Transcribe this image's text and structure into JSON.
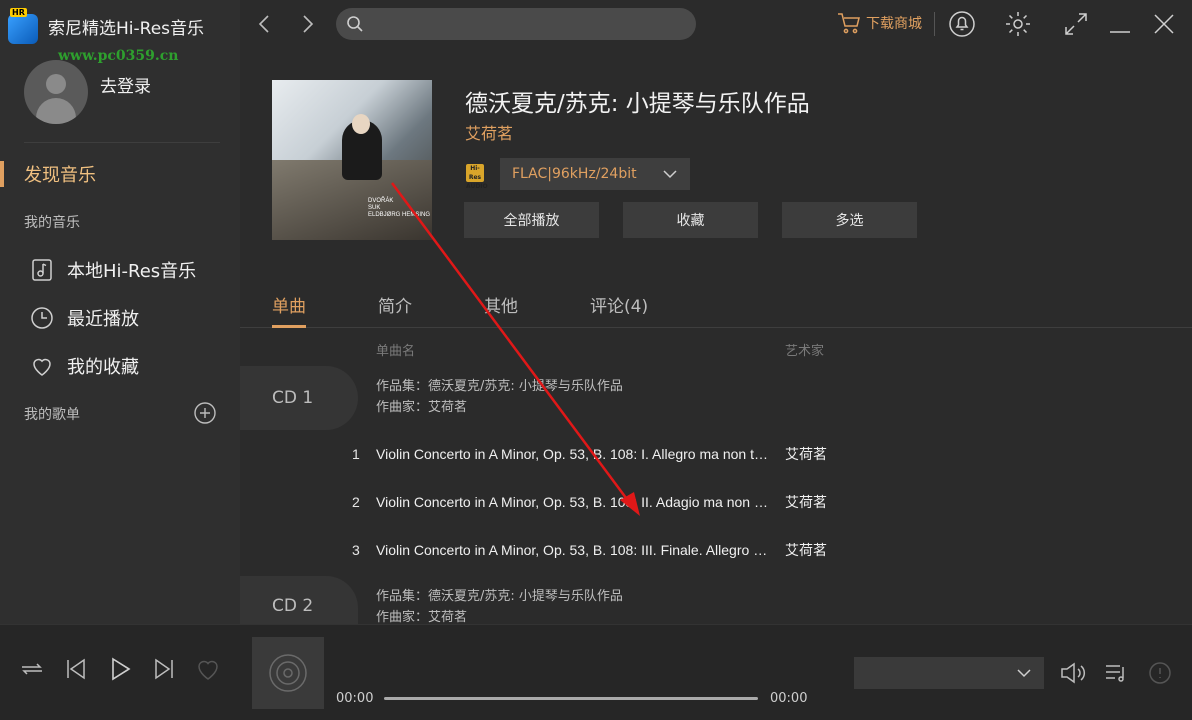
{
  "app": {
    "title": "索尼精选Hi-Res音乐",
    "logo_badge": "HR",
    "watermark": "www.pc0359.cn"
  },
  "sidebar": {
    "login": "去登录",
    "discover": "发现音乐",
    "my_music_label": "我的音乐",
    "items": [
      {
        "label": "本地Hi-Res音乐",
        "icon": "music-note-icon"
      },
      {
        "label": "最近播放",
        "icon": "clock-icon"
      },
      {
        "label": "我的收藏",
        "icon": "heart-icon"
      }
    ],
    "playlists_label": "我的歌单"
  },
  "topbar": {
    "search_placeholder": "",
    "store": "下载商城"
  },
  "album": {
    "title": "德沃夏克/苏克: 小提琴与乐队作品",
    "artist": "艾荷茗",
    "hires_badge": "Hi-Res AUDIO",
    "format": "FLAC|96kHz/24bit",
    "cover_caption": [
      "DVOŘÁK",
      "SUK",
      "ELDBJØRG HEMSING"
    ],
    "actions": [
      "全部播放",
      "收藏",
      "多选"
    ]
  },
  "tabs": [
    "单曲",
    "简介",
    "其他",
    "评论(4)"
  ],
  "tracklist": {
    "col_title": "单曲名",
    "col_artist": "艺术家",
    "discs": [
      {
        "label": "CD 1",
        "album_line": "作品集：德沃夏克/苏克: 小提琴与乐队作品",
        "composer_line": "作曲家：艾荷茗",
        "tracks": [
          {
            "num": "1",
            "name": "Violin Concerto in A Minor, Op. 53, B. 108: I. Allegro ma non troppo",
            "artist": "艾荷茗"
          },
          {
            "num": "2",
            "name": "Violin Concerto in A Minor, Op. 53, B. 108: II. Adagio ma non troppo",
            "artist": "艾荷茗"
          },
          {
            "num": "3",
            "name": "Violin Concerto in A Minor, Op. 53, B. 108: III. Finale. Allegro giocoso",
            "artist": "艾荷茗"
          }
        ]
      },
      {
        "label": "CD 2",
        "album_line": "作品集：德沃夏克/苏克: 小提琴与乐队作品",
        "composer_line": "作曲家：艾荷茗"
      }
    ]
  },
  "player": {
    "time_current": "00:00",
    "time_total": "00:00",
    "progress": 0,
    "quality": ""
  },
  "colors": {
    "accent": "#e0a060",
    "background": "#2b2b2b",
    "sidebar": "#2f2f2f",
    "annotation_arrow": "#e01818"
  }
}
